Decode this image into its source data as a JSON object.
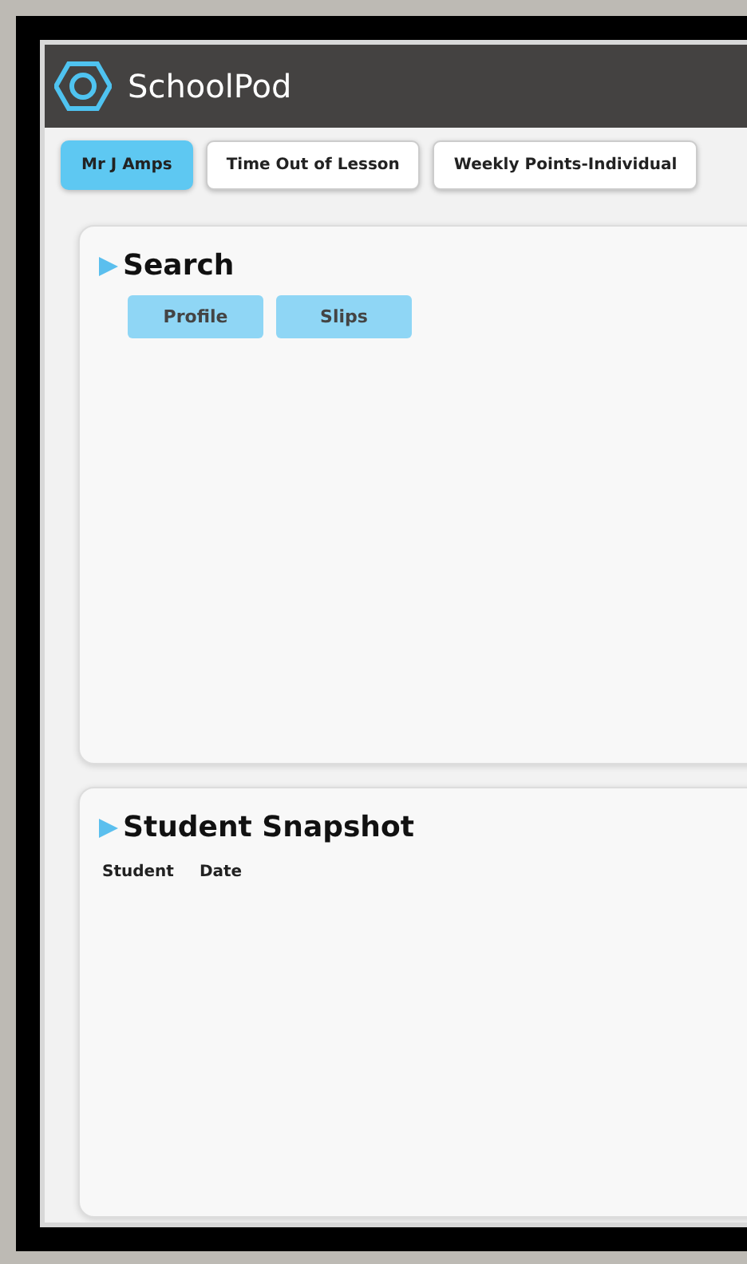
{
  "app": {
    "title": "SchoolPod"
  },
  "tabs": [
    {
      "label": "Mr J Amps",
      "selected": true
    },
    {
      "label": "Time Out of Lesson",
      "selected": false
    },
    {
      "label": "Weekly Points-Individual",
      "selected": false
    }
  ],
  "search": {
    "title": "Search",
    "buttons": [
      "Profile",
      "Slips"
    ]
  },
  "snapshot": {
    "title": "Student Snapshot",
    "columns": [
      "Student",
      "Date"
    ]
  }
}
